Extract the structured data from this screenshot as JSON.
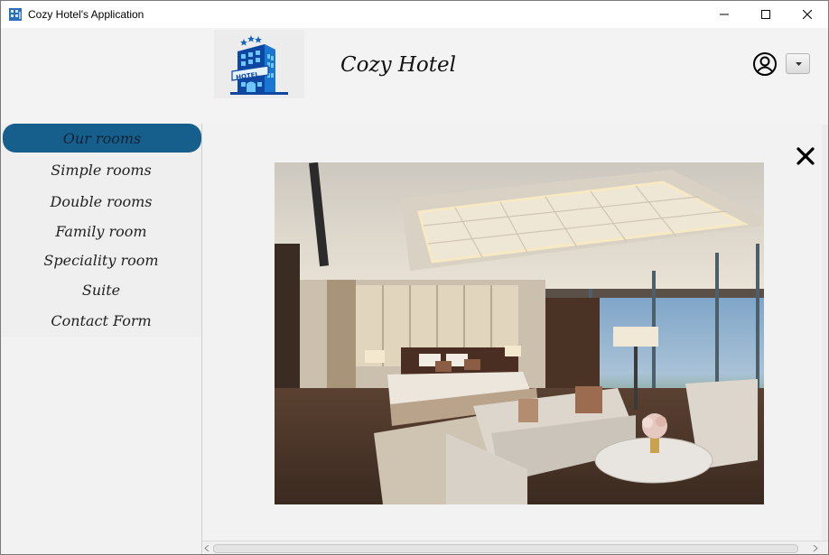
{
  "window": {
    "title": "Cozy Hotel's Application",
    "controls": [
      "minimize-icon",
      "maximize-icon",
      "close-icon"
    ]
  },
  "header": {
    "brand": "Cozy Hotel",
    "logo_text": "HOTEL",
    "user_icon": "user-circle-icon",
    "dropdown_icon": "chevron-down-icon"
  },
  "sidebar": {
    "items": [
      {
        "label": "Our rooms",
        "active": true
      },
      {
        "label": "Simple rooms"
      },
      {
        "label": "Double rooms"
      },
      {
        "label": "Family room"
      },
      {
        "label": "Speciality room"
      },
      {
        "label": "Suite"
      },
      {
        "label": "Contact Form"
      }
    ]
  },
  "main": {
    "close_icon": "close-x-icon",
    "image": "hotel-room-photo"
  },
  "colors": {
    "accent": "#165f8d",
    "logo_blue": "#1565c0",
    "background": "#f2f2f2"
  }
}
